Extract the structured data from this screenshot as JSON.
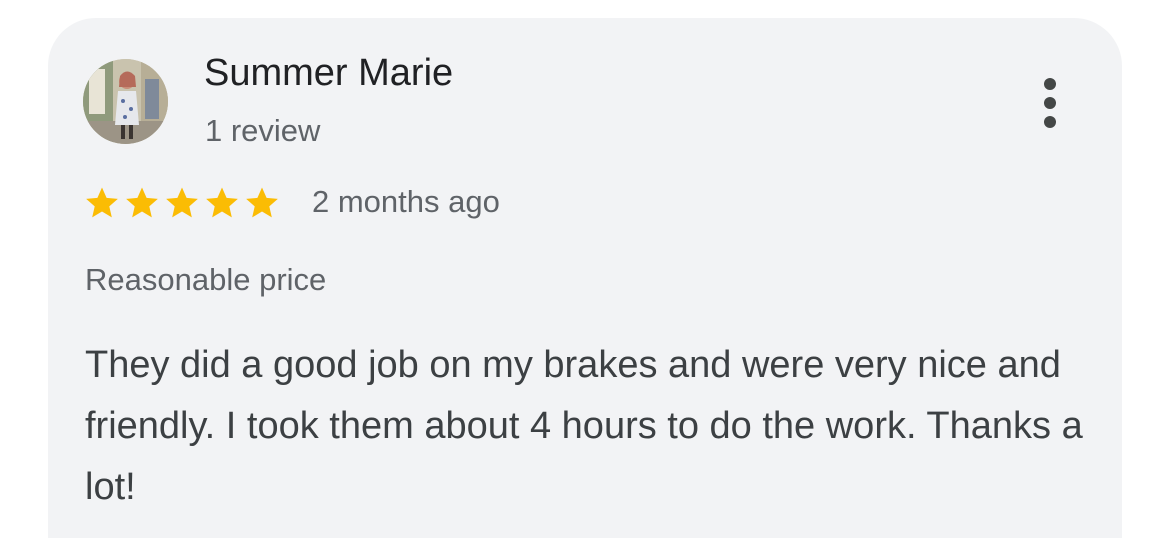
{
  "review": {
    "author": "Summer Marie",
    "review_count": "1 review",
    "rating": 5,
    "rating_max": 5,
    "date": "2 months ago",
    "tag": "Reasonable price",
    "text": "They did a good job on my brakes and were very nice and friendly. I took them about 4 hours to do the work. Thanks a lot!"
  },
  "icons": {
    "star": "star-icon",
    "more": "more-vert-icon",
    "avatar": "avatar-photo"
  },
  "colors": {
    "card_background": "#f2f3f5",
    "star": "#fbbc04",
    "primary_text": "#202124",
    "secondary_text": "#5f6368"
  }
}
